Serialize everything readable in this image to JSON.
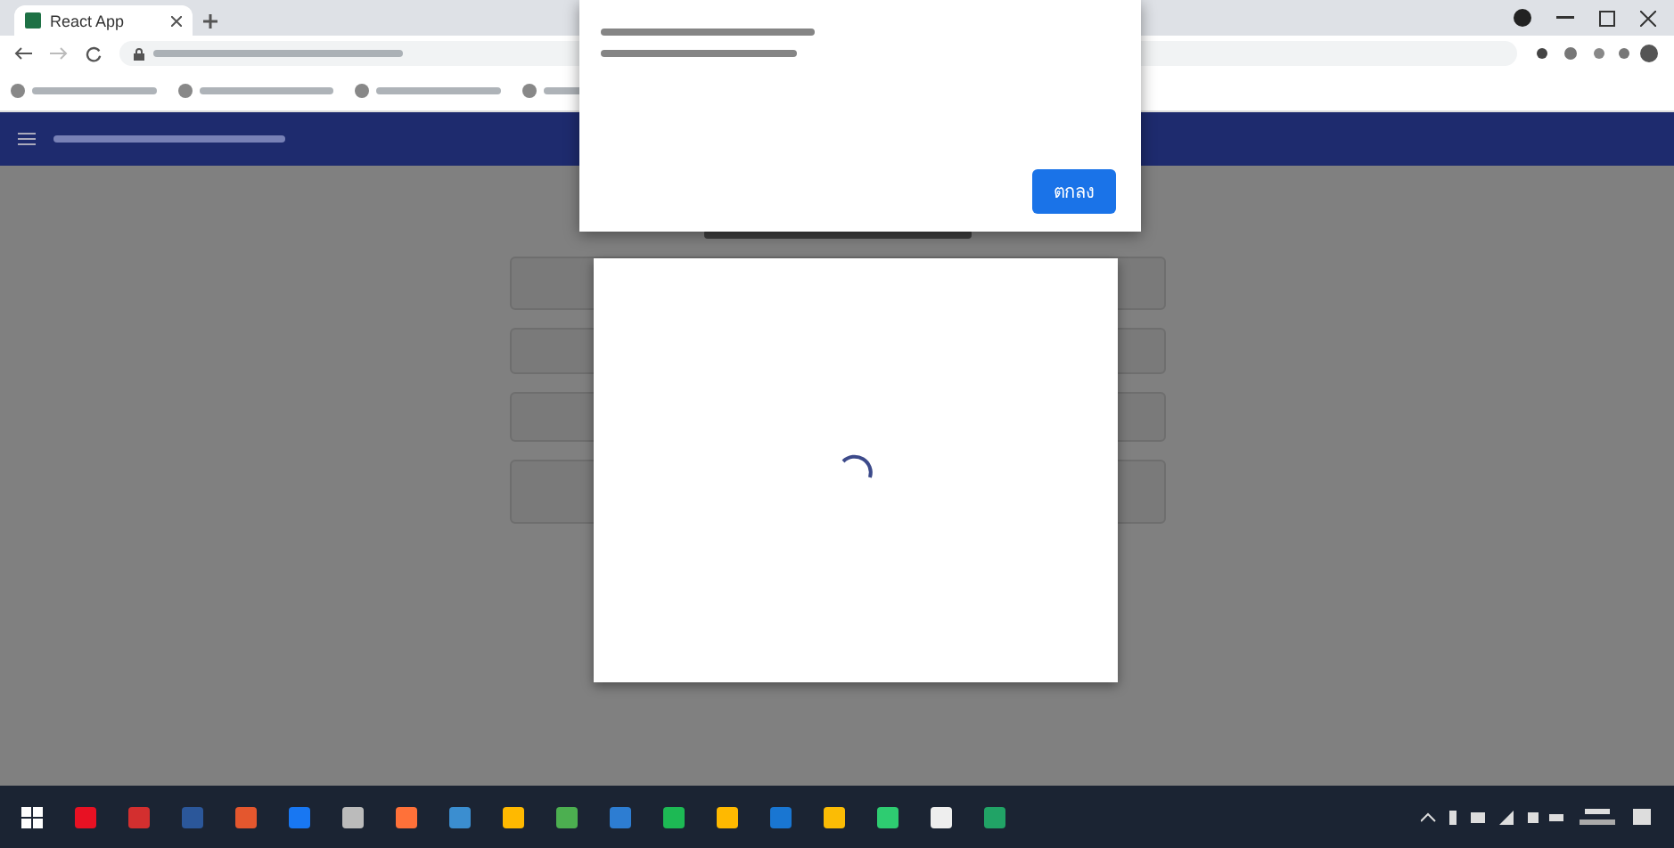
{
  "browser": {
    "tabs": [
      {
        "title": "React App",
        "selected": true
      }
    ]
  },
  "alert": {
    "ok_button": "ตกลง"
  },
  "modal": {
    "loading": true
  }
}
